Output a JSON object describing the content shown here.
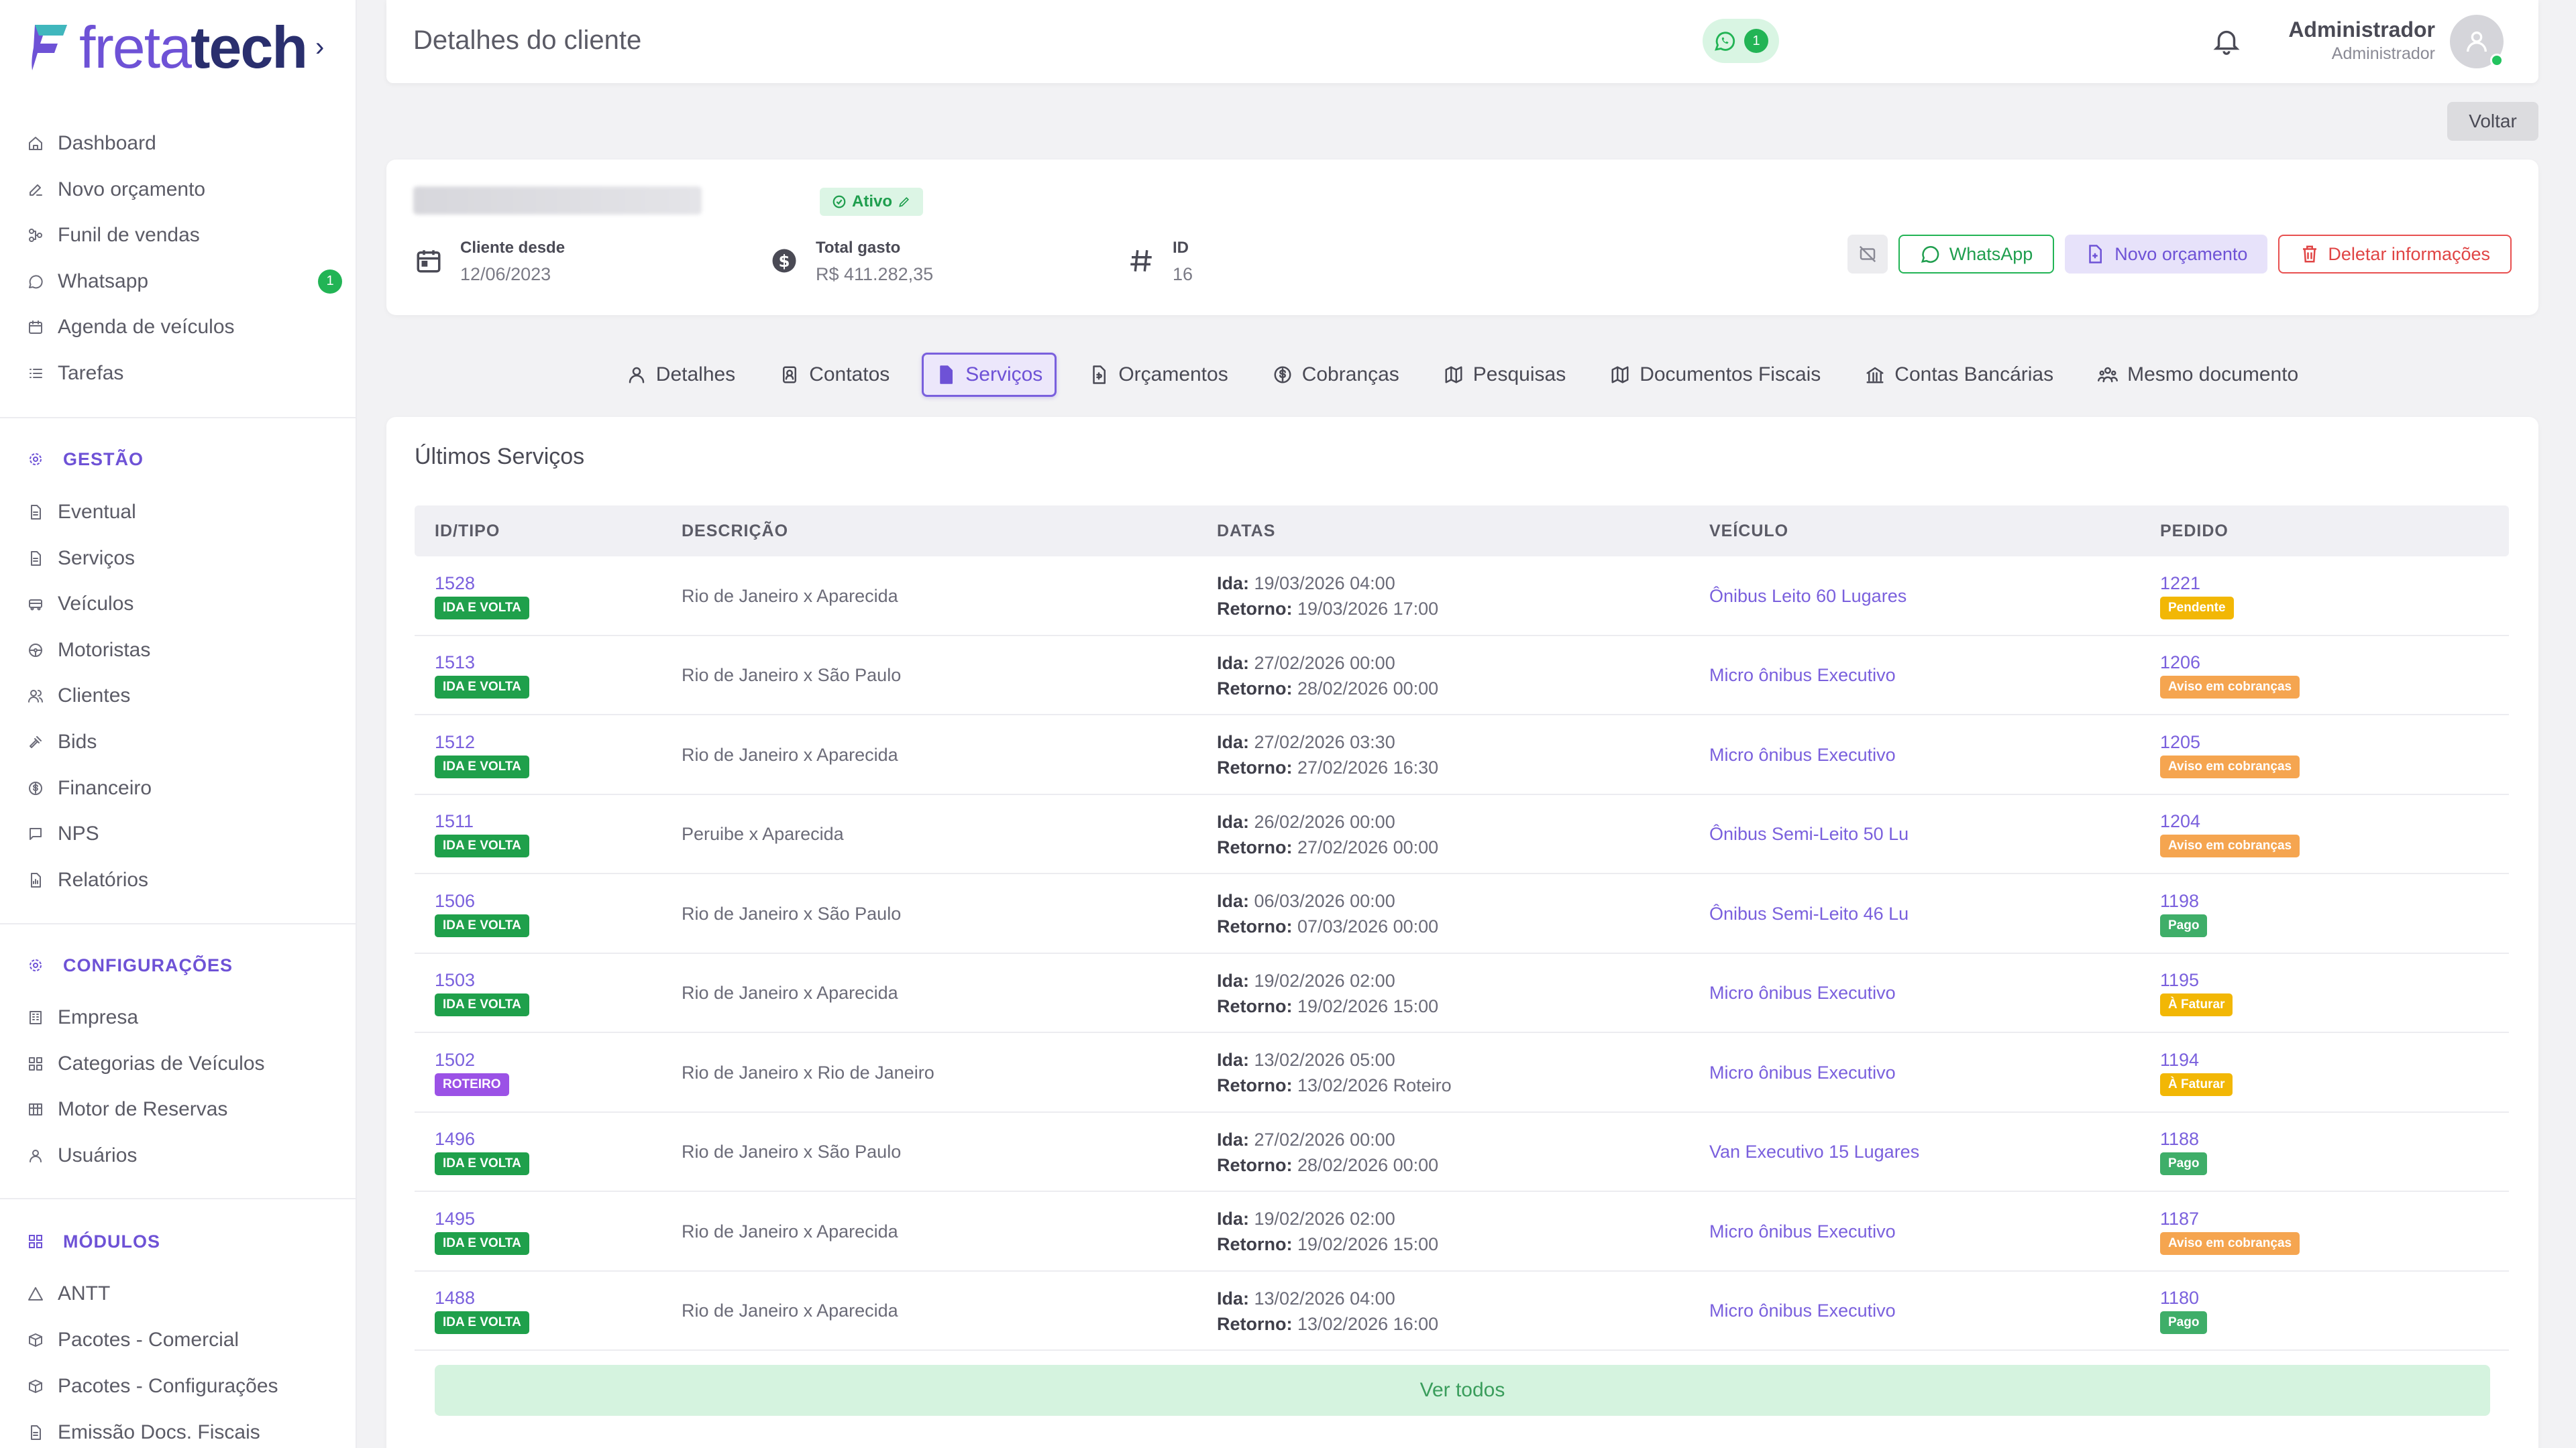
{
  "brand": {
    "name_part1": "freta",
    "name_part2": "tech",
    "accent": "#6e52d6",
    "dark": "#2a2f6e"
  },
  "sidebar": {
    "main_items": [
      {
        "label": "Dashboard",
        "icon": "home-icon"
      },
      {
        "label": "Novo orçamento",
        "icon": "edit-icon"
      },
      {
        "label": "Funil de vendas",
        "icon": "funnel-icon"
      },
      {
        "label": "Whatsapp",
        "icon": "whatsapp-icon",
        "badge": "1"
      },
      {
        "label": "Agenda de veículos",
        "icon": "calendar-icon"
      },
      {
        "label": "Tarefas",
        "icon": "list-icon"
      }
    ],
    "gestao": {
      "title": "GESTÃO",
      "items": [
        "Eventual",
        "Serviços",
        "Veículos",
        "Motoristas",
        "Clientes",
        "Bids",
        "Financeiro",
        "NPS",
        "Relatórios"
      ]
    },
    "config": {
      "title": "CONFIGURAÇÕES",
      "items": [
        "Empresa",
        "Categorias de Veículos",
        "Motor de Reservas",
        "Usuários"
      ]
    },
    "modulos": {
      "title": "MÓDULOS",
      "items": [
        "ANTT",
        "Pacotes - Comercial",
        "Pacotes - Configurações",
        "Emissão Docs. Fiscais"
      ]
    }
  },
  "header": {
    "title": "Detalhes do cliente",
    "whatsapp_count": "1",
    "user_name": "Administrador",
    "user_role": "Administrador"
  },
  "back_button": "Voltar",
  "client": {
    "status": "Ativo",
    "since_label": "Cliente desde",
    "since_value": "12/06/2023",
    "total_label": "Total gasto",
    "total_value": "R$ 411.282,35",
    "id_label": "ID",
    "id_value": "16",
    "actions": {
      "whatsapp": "WhatsApp",
      "new_quote": "Novo orçamento",
      "delete": "Deletar informações"
    }
  },
  "tabs": [
    {
      "label": "Detalhes",
      "icon": "user-icon"
    },
    {
      "label": "Contatos",
      "icon": "contacts-icon"
    },
    {
      "label": "Serviços",
      "icon": "document-icon",
      "active": true
    },
    {
      "label": "Orçamentos",
      "icon": "quote-icon"
    },
    {
      "label": "Cobranças",
      "icon": "dollar-icon"
    },
    {
      "label": "Pesquisas",
      "icon": "map-icon"
    },
    {
      "label": "Documentos Fiscais",
      "icon": "map-icon"
    },
    {
      "label": "Contas Bancárias",
      "icon": "bank-icon"
    },
    {
      "label": "Mesmo documento",
      "icon": "people-icon"
    }
  ],
  "services": {
    "title": "Últimos Serviços",
    "columns": [
      "ID/TIPO",
      "DESCRIÇÃO",
      "DATAS",
      "VEÍCULO",
      "PEDIDO"
    ],
    "ida_label": "Ida:",
    "retorno_label": "Retorno:",
    "rows": [
      {
        "id": "1528",
        "type": "IDA E VOLTA",
        "desc": "Rio de Janeiro x Aparecida",
        "ida": "19/03/2026 04:00",
        "retorno": "19/03/2026 17:00",
        "vehicle": "Ônibus Leito 60 Lugares",
        "order": "1221",
        "status": "Pendente",
        "status_kind": "pendente"
      },
      {
        "id": "1513",
        "type": "IDA E VOLTA",
        "desc": "Rio de Janeiro x São Paulo",
        "ida": "27/02/2026 00:00",
        "retorno": "28/02/2026 00:00",
        "vehicle": "Micro ônibus Executivo",
        "order": "1206",
        "status": "Aviso em cobranças",
        "status_kind": "aviso"
      },
      {
        "id": "1512",
        "type": "IDA E VOLTA",
        "desc": "Rio de Janeiro x Aparecida",
        "ida": "27/02/2026 03:30",
        "retorno": "27/02/2026 16:30",
        "vehicle": "Micro ônibus Executivo",
        "order": "1205",
        "status": "Aviso em cobranças",
        "status_kind": "aviso"
      },
      {
        "id": "1511",
        "type": "IDA E VOLTA",
        "desc": "Peruibe x Aparecida",
        "ida": "26/02/2026 00:00",
        "retorno": "27/02/2026 00:00",
        "vehicle": "Ônibus Semi-Leito 50 Lu",
        "order": "1204",
        "status": "Aviso em cobranças",
        "status_kind": "aviso"
      },
      {
        "id": "1506",
        "type": "IDA E VOLTA",
        "desc": "Rio de Janeiro x São Paulo",
        "ida": "06/03/2026 00:00",
        "retorno": "07/03/2026 00:00",
        "vehicle": "Ônibus Semi-Leito 46 Lu",
        "order": "1198",
        "status": "Pago",
        "status_kind": "pago"
      },
      {
        "id": "1503",
        "type": "IDA E VOLTA",
        "desc": "Rio de Janeiro x Aparecida",
        "ida": "19/02/2026 02:00",
        "retorno": "19/02/2026 15:00",
        "vehicle": "Micro ônibus Executivo",
        "order": "1195",
        "status": "À Faturar",
        "status_kind": "faturar"
      },
      {
        "id": "1502",
        "type": "ROTEIRO",
        "desc": "Rio de Janeiro x Rio de Janeiro",
        "ida": "13/02/2026 05:00",
        "retorno": "13/02/2026 Roteiro",
        "vehicle": "Micro ônibus Executivo",
        "order": "1194",
        "status": "À Faturar",
        "status_kind": "faturar"
      },
      {
        "id": "1496",
        "type": "IDA E VOLTA",
        "desc": "Rio de Janeiro x São Paulo",
        "ida": "27/02/2026 00:00",
        "retorno": "28/02/2026 00:00",
        "vehicle": "Van Executivo 15 Lugares",
        "order": "1188",
        "status": "Pago",
        "status_kind": "pago"
      },
      {
        "id": "1495",
        "type": "IDA E VOLTA",
        "desc": "Rio de Janeiro x Aparecida",
        "ida": "19/02/2026 02:00",
        "retorno": "19/02/2026 15:00",
        "vehicle": "Micro ônibus Executivo",
        "order": "1187",
        "status": "Aviso em cobranças",
        "status_kind": "aviso"
      },
      {
        "id": "1488",
        "type": "IDA E VOLTA",
        "desc": "Rio de Janeiro x Aparecida",
        "ida": "13/02/2026 04:00",
        "retorno": "13/02/2026 16:00",
        "vehicle": "Micro ônibus Executivo",
        "order": "1180",
        "status": "Pago",
        "status_kind": "pago"
      }
    ],
    "see_all": "Ver todos"
  }
}
